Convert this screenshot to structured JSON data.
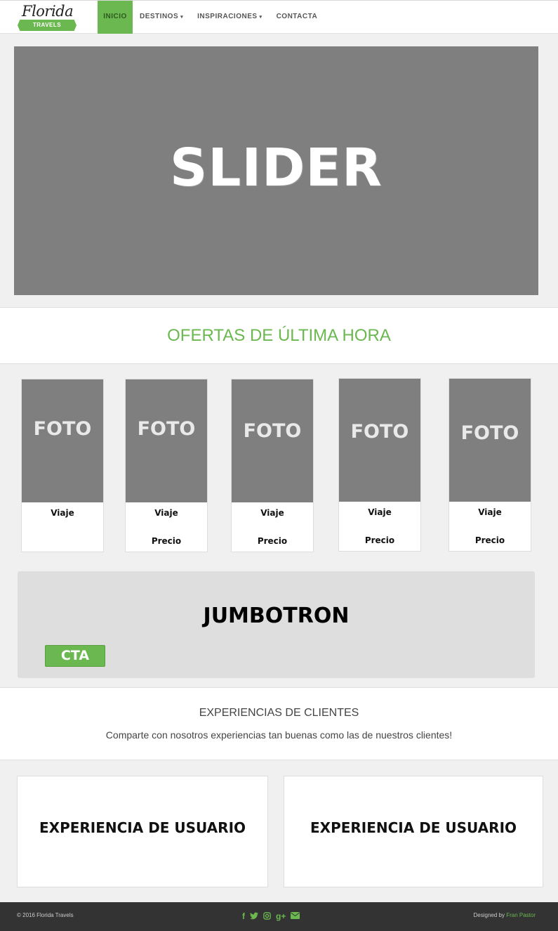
{
  "brand": {
    "script": "Florida",
    "band": "TRAVELS"
  },
  "nav": {
    "items": [
      {
        "label": "INICIO"
      },
      {
        "label": "DESTINOS"
      },
      {
        "label": "INSPIRACIONES"
      },
      {
        "label": "CONTACTA"
      }
    ]
  },
  "slider": {
    "label": "SLIDER"
  },
  "offers": {
    "title": "OFERTAS DE ÚLTIMA HORA"
  },
  "cards": [
    {
      "photo": "FOTO",
      "trip": "Viaje",
      "price": ""
    },
    {
      "photo": "FOTO",
      "trip": "Viaje",
      "price": "Precio"
    },
    {
      "photo": "FOTO",
      "trip": "Viaje",
      "price": "Precio"
    },
    {
      "photo": "FOTO",
      "trip": "Viaje",
      "price": "Precio"
    },
    {
      "photo": "FOTO",
      "trip": "Viaje",
      "price": "Precio"
    }
  ],
  "jumbotron": {
    "title": "JUMBOTRON",
    "cta": "CTA"
  },
  "experiences": {
    "title": "EXPERIENCIAS DE CLIENTES",
    "subtitle": "Comparte con nosotros experiencias tan buenas como las de nuestros clientes!",
    "cards": [
      {
        "label": "EXPERIENCIA DE USUARIO"
      },
      {
        "label": "EXPERIENCIA DE USUARIO"
      }
    ]
  },
  "footer": {
    "copyright": "© 2016 Florida Travels",
    "designed_by": "Designed by",
    "author": "Fran Pastor",
    "social": [
      {
        "icon": "facebook-icon",
        "glyph": "f"
      },
      {
        "icon": "twitter-icon",
        "glyph": "🐦"
      },
      {
        "icon": "instagram-icon",
        "glyph": "◙"
      },
      {
        "icon": "google-plus-icon",
        "glyph": "g+"
      },
      {
        "icon": "email-icon",
        "glyph": "✉"
      }
    ]
  },
  "colors": {
    "accent": "#6ab84f",
    "placeholder": "#7f7f7f",
    "footer": "#333333"
  }
}
